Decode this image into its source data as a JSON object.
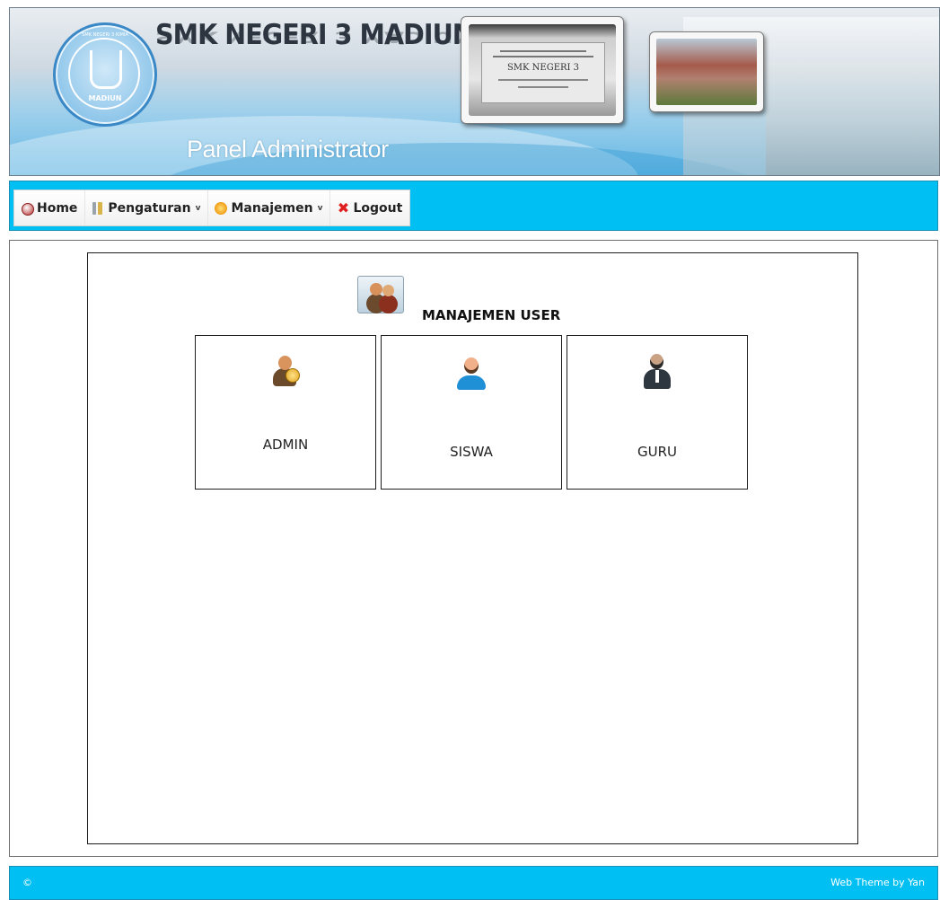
{
  "header": {
    "school_name": "SMK NEGERI 3 MADIUN",
    "panel_title": "Panel Administrator",
    "logo_city": "MADIUN",
    "logo_arc": "SMK NEGERI 3 KIMIA",
    "plaque_text": "SMK NEGERI 3"
  },
  "nav": {
    "items": [
      {
        "label": "Home",
        "icon": "home-icon"
      },
      {
        "label": "Pengaturan",
        "icon": "settings-icon",
        "has_dropdown": true
      },
      {
        "label": "Manajemen",
        "icon": "manage-icon",
        "has_dropdown": true
      },
      {
        "label": "Logout",
        "icon": "logout-icon"
      }
    ],
    "caret": "v",
    "logout_glyph": "✖"
  },
  "main": {
    "title": "MANAJEMEN USER",
    "title_icon": "user-management-icon",
    "cards": [
      {
        "label": "ADMIN",
        "icon": "admin-user-icon"
      },
      {
        "label": "SISWA",
        "icon": "student-user-icon"
      },
      {
        "label": "GURU",
        "icon": "teacher-user-icon"
      }
    ]
  },
  "footer": {
    "copyright": "©",
    "credit": "Web Theme by Yan"
  },
  "colors": {
    "nav_bar": "#00bff2",
    "footer_bar": "#00bff2",
    "banner_blue": "#66b8e4",
    "border_dark": "#1d1d1d"
  }
}
